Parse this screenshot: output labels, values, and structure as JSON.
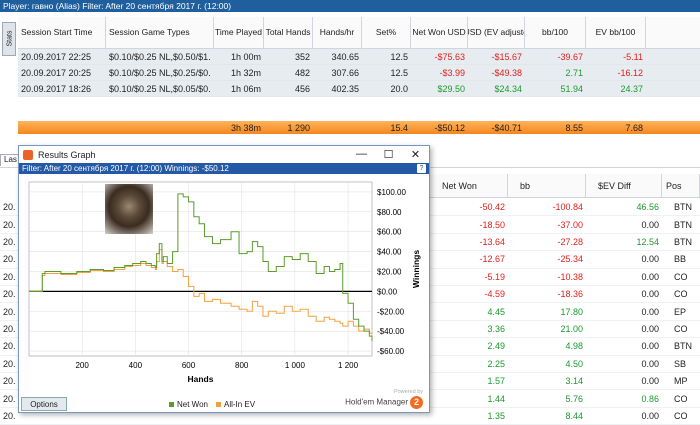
{
  "topbar": {
    "text": "Player: гавно (Alias)   Filter: After 20 сентября 2017 г. (12:00)"
  },
  "stats_tab": "Stats",
  "sessions": {
    "headers": [
      "Session Start Time",
      "Session Game Types",
      "Time Played",
      "Total Hands",
      "Hands/hr",
      "Set%",
      "Net Won USD",
      "$ USD (EV adjusted)",
      "bb/100",
      "EV bb/100"
    ],
    "rows": [
      [
        "20.09.2017 22:25",
        "$0.10/$0.25 NL,$0.50/$1.",
        "1h 00m",
        "352",
        "340.65",
        "12.5",
        "-$75.63",
        "-$15.67",
        "-39.67",
        "-5.11"
      ],
      [
        "20.09.2017 20:25",
        "$0.10/$0.25 NL,$0.25/$0.",
        "1h 32m",
        "482",
        "307.66",
        "12.5",
        "-$3.99",
        "-$49.38",
        "2.71",
        "-16.12"
      ],
      [
        "20.09.2017 18:26",
        "$0.10/$0.25 NL,$0.05/$0.",
        "1h 06m",
        "456",
        "402.35",
        "20.0",
        "$29.50",
        "$24.34",
        "51.94",
        "24.37"
      ]
    ],
    "colors": [
      [
        "",
        "",
        "",
        "",
        "",
        "",
        "neg",
        "neg",
        "neg",
        "neg"
      ],
      [
        "",
        "",
        "",
        "",
        "",
        "",
        "neg",
        "neg",
        "pos",
        "neg"
      ],
      [
        "",
        "",
        "",
        "",
        "",
        "",
        "pos",
        "pos",
        "pos",
        "pos"
      ]
    ],
    "total": [
      "",
      "",
      "3h 38m",
      "1 290",
      "",
      "15.4",
      "-$50.12",
      "-$40.71",
      "8.55",
      "7.68"
    ]
  },
  "lower_tab": "Las",
  "hands": {
    "headers": [
      "Net Won",
      "bb",
      "$EV Diff",
      "Pos"
    ],
    "rows": [
      [
        "-50.42",
        "-100.84",
        "46.56",
        "BTN"
      ],
      [
        "-18.50",
        "-37.00",
        "0.00",
        "BTN"
      ],
      [
        "-13.64",
        "-27.28",
        "12.54",
        "BTN"
      ],
      [
        "-12.67",
        "-25.34",
        "0.00",
        "BB"
      ],
      [
        "-5.19",
        "-10.38",
        "0.00",
        "CO"
      ],
      [
        "-4.59",
        "-18.36",
        "0.00",
        "CO"
      ],
      [
        "4.45",
        "17.80",
        "0.00",
        "EP"
      ],
      [
        "3.36",
        "21.00",
        "0.00",
        "CO"
      ],
      [
        "2.49",
        "4.98",
        "0.00",
        "BTN"
      ],
      [
        "2.25",
        "4.50",
        "0.00",
        "SB"
      ],
      [
        "1.57",
        "3.14",
        "0.00",
        "MP"
      ],
      [
        "1.44",
        "5.76",
        "0.86",
        "CO"
      ],
      [
        "1.35",
        "8.44",
        "0.00",
        "CO"
      ]
    ],
    "left_stub": "20."
  },
  "results_window": {
    "title": "Results Graph",
    "controls": [
      "—",
      "☐",
      "✕"
    ],
    "filter": "Filter: After 20 сентября 2017 г. (12:00)   Winnings: -$50.12",
    "help": "?",
    "options_label": "Options",
    "legend": [
      {
        "name": "Net Won",
        "color": "#5a9c2e"
      },
      {
        "name": "All-In EV",
        "color": "#f5a040"
      }
    ],
    "powered": "Powered by",
    "brand": "Hold'em Manager",
    "logo_digit": "2"
  },
  "chart_data": {
    "type": "line",
    "xlabel": "Hands",
    "ylabel": "Winnings",
    "x_ticks": [
      200,
      400,
      600,
      800,
      1000,
      1200
    ],
    "x_tick_labels": [
      "200",
      "400",
      "600",
      "800",
      "1 000",
      "1 200"
    ],
    "y_ticks": [
      100,
      80,
      60,
      40,
      20,
      0,
      -20,
      -40,
      -60
    ],
    "y_tick_labels": [
      "$100.00",
      "$80.00",
      "$60.00",
      "$40.00",
      "$20.00",
      "$0.00",
      "-$20.00",
      "-$40.00",
      "-$60.00"
    ],
    "xlim": [
      0,
      1290
    ],
    "ylim": [
      -65,
      110
    ],
    "grid": true,
    "series": [
      {
        "name": "Net Won",
        "color": "#5a9c2e",
        "x": [
          0,
          50,
          60,
          120,
          180,
          230,
          280,
          320,
          360,
          390,
          420,
          440,
          460,
          475,
          480,
          490,
          500,
          505,
          520,
          540,
          560,
          580,
          600,
          620,
          640,
          660,
          690,
          720,
          760,
          790,
          820,
          840,
          860,
          880,
          900,
          930,
          960,
          990,
          1020,
          1050,
          1080,
          1110,
          1130,
          1150,
          1170,
          1180,
          1200,
          1220,
          1240,
          1260,
          1280,
          1290
        ],
        "y": [
          0,
          18,
          20,
          18,
          20,
          22,
          21,
          24,
          26,
          28,
          30,
          28,
          26,
          24,
          38,
          48,
          30,
          35,
          28,
          40,
          98,
          95,
          90,
          75,
          68,
          55,
          48,
          52,
          60,
          38,
          40,
          50,
          45,
          30,
          20,
          25,
          35,
          32,
          38,
          30,
          18,
          25,
          20,
          22,
          28,
          -2,
          -12,
          -28,
          -35,
          -40,
          -45,
          -50
        ]
      },
      {
        "name": "All-In EV",
        "color": "#f5a040",
        "x": [
          0,
          50,
          60,
          120,
          180,
          230,
          280,
          320,
          360,
          390,
          420,
          440,
          460,
          475,
          480,
          490,
          500,
          505,
          520,
          540,
          560,
          580,
          600,
          620,
          640,
          660,
          690,
          720,
          760,
          790,
          820,
          840,
          860,
          880,
          900,
          930,
          960,
          990,
          1020,
          1050,
          1080,
          1110,
          1130,
          1150,
          1170,
          1180,
          1200,
          1220,
          1240,
          1260,
          1280,
          1290
        ],
        "y": [
          0,
          16,
          18,
          17,
          19,
          21,
          20,
          22,
          25,
          26,
          28,
          26,
          24,
          22,
          30,
          42,
          28,
          30,
          25,
          20,
          22,
          15,
          5,
          -5,
          -2,
          -10,
          -8,
          -12,
          -15,
          -18,
          -20,
          -10,
          -15,
          -25,
          -20,
          -22,
          -15,
          -20,
          -18,
          -25,
          -30,
          -26,
          -28,
          -30,
          -32,
          -35,
          -30,
          -35,
          -40,
          -38,
          -42,
          -41
        ]
      }
    ]
  }
}
